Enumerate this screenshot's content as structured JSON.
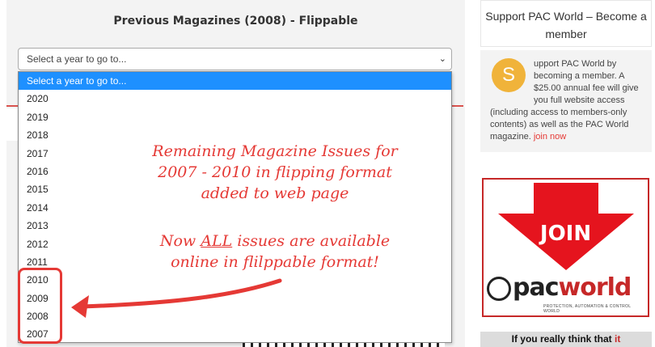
{
  "main": {
    "title": "Previous Magazines (2008) - Flippable",
    "select_value": "Select a year to go to...",
    "dropdown": {
      "items": [
        "Select a year to go to...",
        "2020",
        "2019",
        "2018",
        "2017",
        "2016",
        "2015",
        "2014",
        "2013",
        "2012",
        "2011",
        "2010",
        "2009",
        "2008",
        "2007"
      ],
      "selected_index": 0
    }
  },
  "annotation": {
    "line1": "Remaining Magazine Issues for",
    "line2": "2007 - 2010 in flipping format",
    "line3": "added to web page",
    "line4_pre": "Now ",
    "line4_emph": "ALL",
    "line4_post": " issues are available",
    "line5": "online in flilppable format!",
    "color": "#e53935"
  },
  "sidebar": {
    "support_title": "Support PAC World – Become a member",
    "avatar_letter": "S",
    "member_text": "upport PAC World by becoming a member. A $25.00 annual fee will give you full website access (including access to members-only contents) as well as the PAC World magazine.",
    "join_link": "join now",
    "join_banner": "JOIN",
    "logo_pac": "pac",
    "logo_world": "world",
    "logo_tagline": "PROTECTION, AUTOMATION & CONTROL WORLD",
    "bottom_pre": "If you really think that ",
    "bottom_emph": "it"
  },
  "colors": {
    "selected_bg": "#1e90ff",
    "accent_red": "#e53935",
    "avatar": "#f0b33a"
  }
}
